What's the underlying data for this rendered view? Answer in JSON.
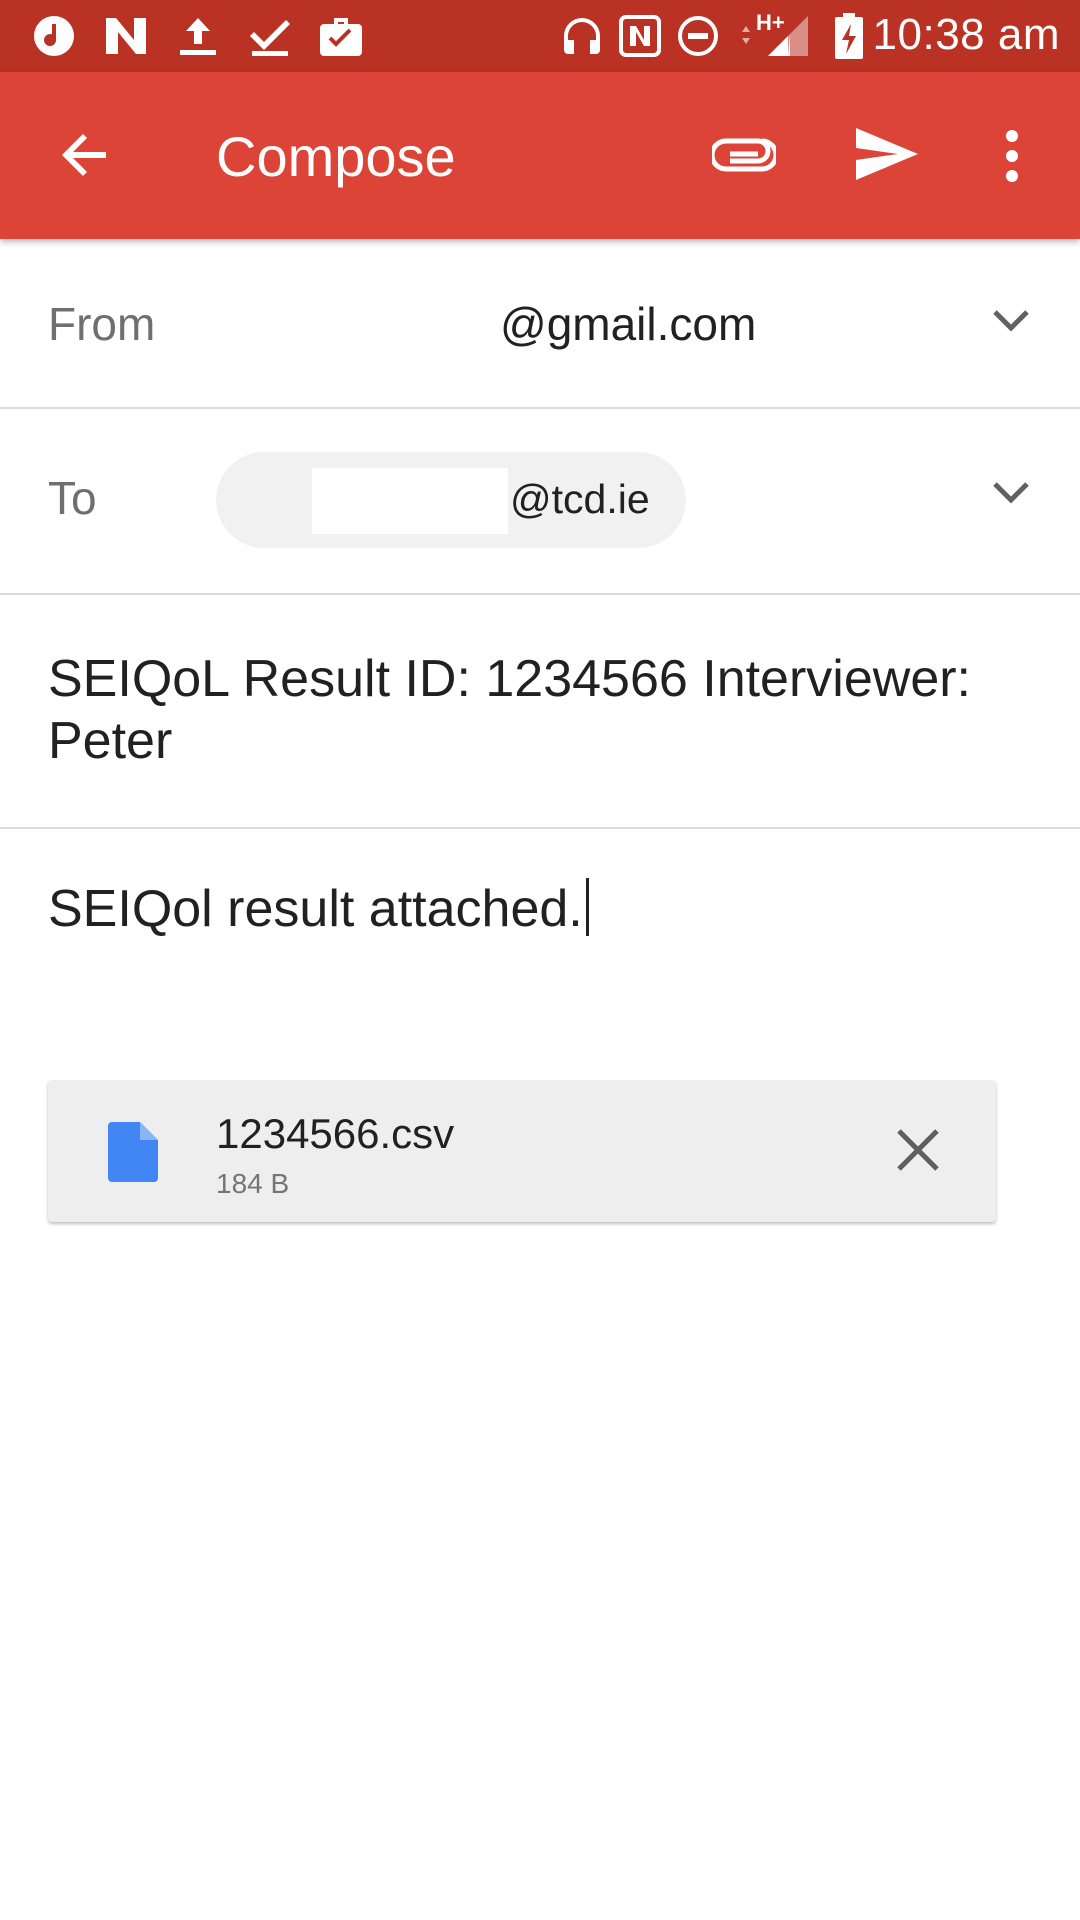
{
  "status_bar": {
    "time": "10:38 am",
    "left_icons": [
      "music-note-icon",
      "n-logo-icon",
      "upload-icon",
      "download-done-icon",
      "briefcase-check-icon"
    ],
    "right_icons": [
      "headphones-icon",
      "nfc-icon",
      "do-not-disturb-icon",
      "network-h-plus-icon",
      "signal-icon",
      "battery-charging-icon"
    ],
    "network_label": "H+"
  },
  "app_bar": {
    "title": "Compose",
    "background": "#db4437",
    "icons": [
      "back-arrow-icon",
      "paperclip-icon",
      "send-icon",
      "more-vert-icon"
    ]
  },
  "from_field": {
    "label": "From",
    "value": "@gmail.com"
  },
  "to_field": {
    "label": "To",
    "chip_text": "@tcd.ie"
  },
  "subject": "SEIQoL Result ID: 1234566 Interviewer: Peter",
  "body": "SEIQol result attached.",
  "attachment": {
    "filename": "1234566.csv",
    "size": "184 B",
    "icon": "file-icon",
    "icon_color": "#4285f4"
  }
}
